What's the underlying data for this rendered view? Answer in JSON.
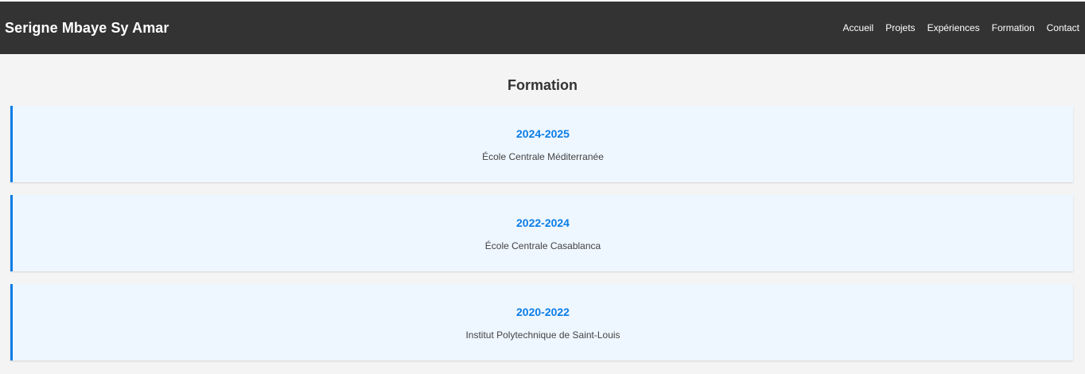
{
  "header": {
    "brand": "Serigne Mbaye Sy Amar",
    "nav": [
      "Accueil",
      "Projets",
      "Expériences",
      "Formation",
      "Contact"
    ]
  },
  "formation": {
    "title": "Formation",
    "items": [
      {
        "years": "2024-2025",
        "school": "École Centrale Méditerranée"
      },
      {
        "years": "2022-2024",
        "school": "École Centrale Casablanca"
      },
      {
        "years": "2020-2022",
        "school": "Institut Polytechnique de Saint-Louis"
      }
    ]
  },
  "colors": {
    "header_bg": "#333333",
    "page_bg": "#f4f4f4",
    "accent": "#0a7de6",
    "card_bg": "#eef6ff"
  }
}
